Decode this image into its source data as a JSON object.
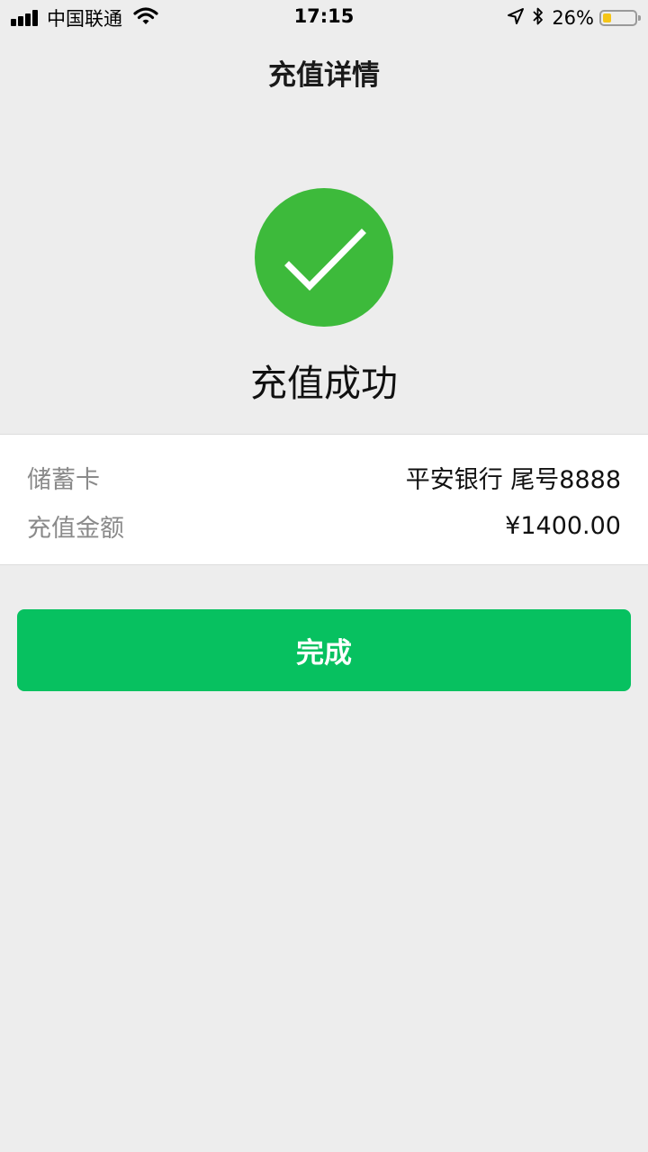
{
  "status_bar": {
    "carrier": "中国联通",
    "time": "17:15",
    "battery_percent": "26%",
    "battery_level": 0.26,
    "icons": [
      "signal-icon",
      "wifi-icon",
      "location-icon",
      "bluetooth-icon",
      "battery-icon"
    ]
  },
  "nav": {
    "title": "充值详情"
  },
  "result": {
    "icon": "checkmark-icon",
    "title": "充值成功",
    "success_color": "#3dba3b"
  },
  "details": {
    "card_label": "储蓄卡",
    "card_value": "平安银行 尾号8888",
    "amount_label": "充值金额",
    "amount_value": "¥1400.00"
  },
  "actions": {
    "done_label": "完成",
    "done_color": "#07c160"
  }
}
